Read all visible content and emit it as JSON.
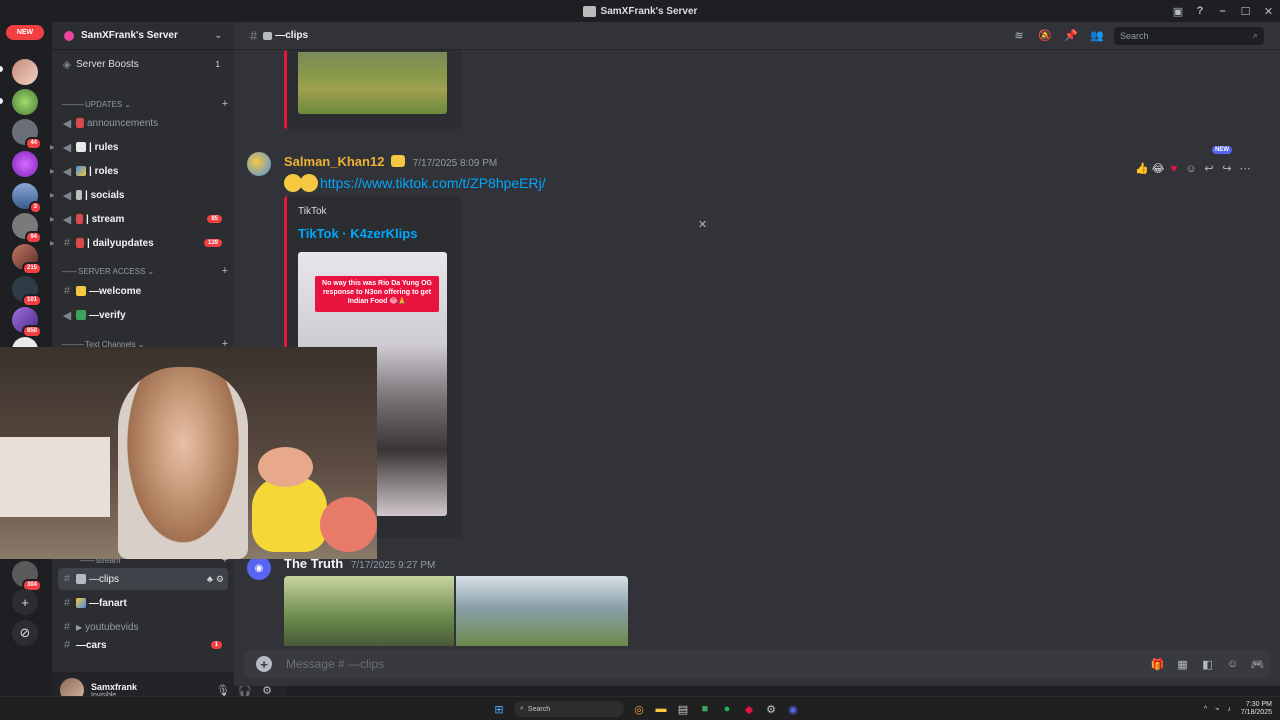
{
  "window": {
    "title": "SamXFrank's Server"
  },
  "rail": {
    "new_badge": "NEW",
    "servers": [
      {
        "badge": "",
        "color": "#c58a7a",
        "active": true
      },
      {
        "badge": "",
        "color": "#5f8f4a",
        "active": false
      },
      {
        "badge": "44",
        "color": "#6b6f7a",
        "active": false
      },
      {
        "badge": "",
        "color": "#9a38c9",
        "active": false
      },
      {
        "badge": "3",
        "color": "#4b6fa8",
        "active": false
      },
      {
        "badge": "94",
        "color": "#7a7a7a",
        "active": false
      },
      {
        "badge": "215",
        "color": "#9a5a4a",
        "active": false
      },
      {
        "badge": "101",
        "color": "#2e3a44",
        "active": false
      },
      {
        "badge": "850",
        "color": "#6a4aa8",
        "active": false
      }
    ],
    "lower_server_badge": "304",
    "add_icon": "plus-icon",
    "discover_icon": "compass-icon"
  },
  "sidebar": {
    "server_name": "SamXFrank's Server",
    "boosts": {
      "label": "Server Boosts",
      "count": "1"
    },
    "categories": {
      "updates": "UPDATES",
      "server_access": "SERVER ACCESS",
      "text_channels": "Text Channels",
      "stream": "stream"
    },
    "channels": {
      "announcements": {
        "label": "announcements",
        "count": ""
      },
      "rules": {
        "label": "| rules",
        "count": ""
      },
      "roles": {
        "label": "| roles",
        "count": ""
      },
      "socials": {
        "label": "| socials",
        "count": ""
      },
      "stream": {
        "label": "| stream",
        "count": "85"
      },
      "dailyupdates": {
        "label": "| dailyupdates",
        "count": "139"
      },
      "welcome": {
        "label": "—welcome",
        "count": ""
      },
      "verify": {
        "label": "—verify",
        "count": ""
      },
      "clips": {
        "label": "—clips",
        "count": ""
      },
      "fanart": {
        "label": "—fanart",
        "count": ""
      },
      "youtubevids": {
        "label": "youtubevids",
        "count": ""
      },
      "cars": {
        "label": "—cars",
        "count": "1"
      }
    }
  },
  "user": {
    "name": "Samxfrank",
    "status": "Invisible"
  },
  "channel_header": {
    "name": "—clips",
    "search_placeholder": "Search"
  },
  "messages": [
    {
      "author": "Salman_Khan12",
      "author_color": "#f0b232",
      "timestamp": "7/17/2025 8:09 PM",
      "link": "https://www.tiktok.com/t/ZP8hpeERj/",
      "embed": {
        "provider": "TikTok",
        "title": "TikTok · K4zerKlips",
        "caption": "No way this was Rio Da Yung OG response to N3on offering to get Indian Food 😂🙏"
      },
      "reactions_bar_badge": "NEW"
    },
    {
      "author": "The Truth",
      "author_color": "#f2f3f5",
      "timestamp": "7/17/2025 9:27 PM"
    }
  ],
  "composer": {
    "placeholder": "Message # —clips"
  },
  "taskbar": {
    "search": "Search",
    "time": "7:30 PM",
    "date": "7/18/2025"
  }
}
